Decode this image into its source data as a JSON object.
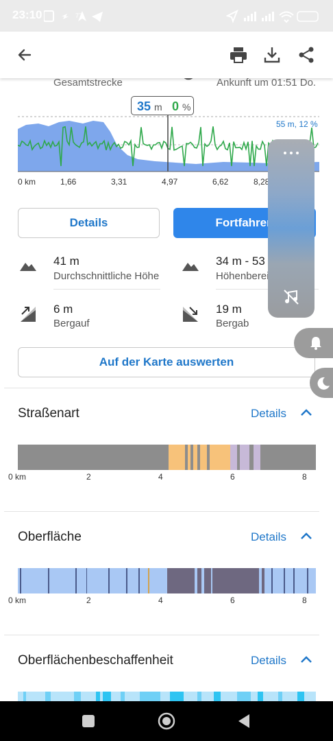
{
  "status_bar": {
    "time": "23:10",
    "battery": "77"
  },
  "header": {
    "back_icon": "arrow-left-icon",
    "print_icon": "printer-icon",
    "download_icon": "download-icon",
    "share_icon": "share-icon"
  },
  "summary": {
    "left_label": "Gesamtstrecke",
    "right_label": "Ankunft um 01:51 Do."
  },
  "elevation_chart": {
    "tooltip_height_value": "35",
    "tooltip_height_unit": "m",
    "tooltip_slope_value": "0",
    "tooltip_slope_unit": "%",
    "legend_text": "55 m, 12 %",
    "x_ticks": [
      "0 km",
      "1,66",
      "3,31",
      "4,97",
      "6,62",
      "8,28"
    ],
    "colors": {
      "elevation_fill": "#7ea7ec",
      "slope_line": "#2ea84a",
      "accent": "#1f77c9"
    }
  },
  "actions": {
    "details_label": "Details",
    "continue_label": "Fortfahren"
  },
  "stats": {
    "avg_height_value": "41 m",
    "avg_height_label": "Durchschnittliche Höhe",
    "range_value": "34 m - 53 m",
    "range_label": "Höhenbereich",
    "uphill_value": "6 m",
    "uphill_label": "Bergauf",
    "downhill_value": "19 m",
    "downhill_label": "Bergab"
  },
  "evaluate_button": "Auf der Karte auswerten",
  "sections": {
    "road_type": {
      "title": "Straßenart",
      "details": "Details"
    },
    "surface": {
      "title": "Oberfläche",
      "details": "Details"
    },
    "smoothness": {
      "title": "Oberflächenbeschaffenheit",
      "details": "Details"
    }
  },
  "bar_axis": [
    "0 km",
    "2",
    "4",
    "6",
    "8"
  ],
  "overlay": {
    "menu_icon": "more-horizontal-icon",
    "music_icon": "music-off-icon",
    "bell_icon": "bell-icon",
    "moon_icon": "moon-icon"
  },
  "nav": {
    "recent_icon": "square-icon",
    "home_icon": "circle-icon",
    "back_icon": "triangle-back-icon"
  }
}
